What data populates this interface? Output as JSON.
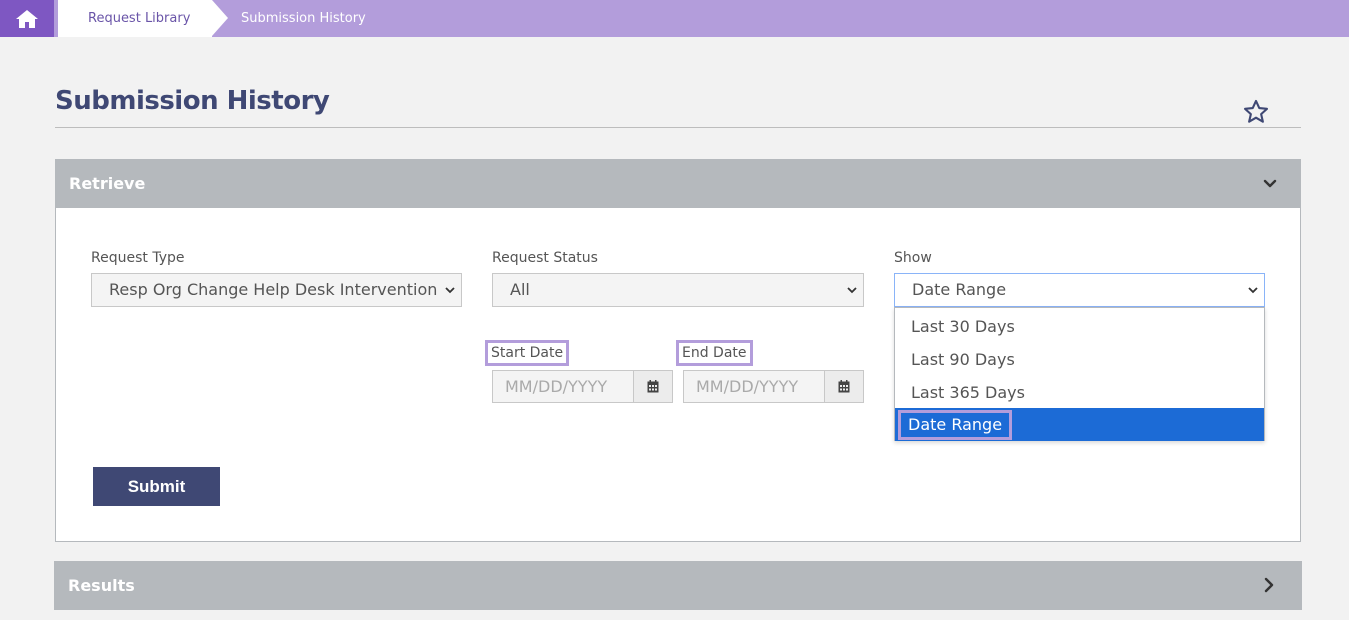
{
  "breadcrumb": {
    "home_icon": "home-icon",
    "items": [
      "Request Library",
      "Submission History"
    ]
  },
  "page": {
    "title": "Submission History",
    "favorite_icon": "star-outline-icon"
  },
  "retrieve": {
    "title": "Retrieve",
    "collapse_icon": "chevron-down-icon",
    "request_type": {
      "label": "Request Type",
      "value": "Resp Org Change Help Desk Intervention"
    },
    "request_status": {
      "label": "Request Status",
      "value": "All"
    },
    "show": {
      "label": "Show",
      "value": "Date Range",
      "options": [
        "Last 30 Days",
        "Last 90 Days",
        "Last 365 Days",
        "Date Range"
      ]
    },
    "start_date": {
      "label": "Start Date",
      "placeholder": "MM/DD/YYYY",
      "icon": "calendar-icon"
    },
    "end_date": {
      "label": "End Date",
      "placeholder": "MM/DD/YYYY",
      "icon": "calendar-icon"
    },
    "submit_label": "Submit"
  },
  "results": {
    "title": "Results",
    "expand_icon": "chevron-right-icon"
  },
  "colors": {
    "topbar": "#b39ddb",
    "accent": "#3f4874",
    "panel_header": "#b5b9bd",
    "selected_option": "#1c6bd6"
  }
}
